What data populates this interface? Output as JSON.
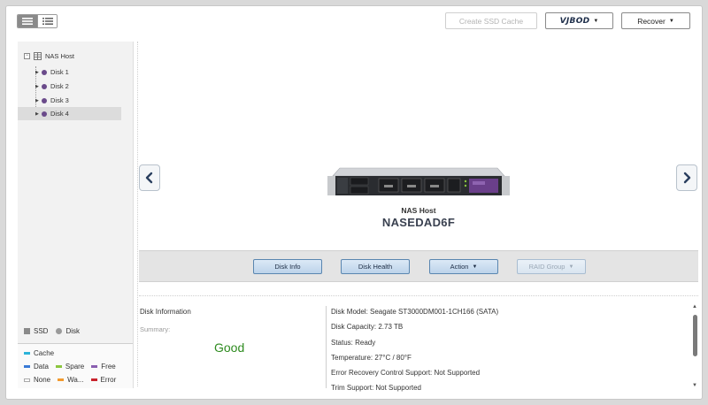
{
  "toolbar": {
    "create_ssd_cache": "Create SSD Cache",
    "vjbod": "VJBOD",
    "recover": "Recover"
  },
  "tree": {
    "root": "NAS Host",
    "items": [
      {
        "label": "Disk 1",
        "selected": false
      },
      {
        "label": "Disk 2",
        "selected": false
      },
      {
        "label": "Disk 3",
        "selected": false
      },
      {
        "label": "Disk 4",
        "selected": true
      }
    ]
  },
  "type_legend": {
    "ssd": "SSD",
    "disk": "Disk"
  },
  "status_legend": {
    "cache": "Cache",
    "data": "Data",
    "spare": "Spare",
    "free": "Free",
    "none": "None",
    "warning": "Wa...",
    "error": "Error"
  },
  "colors": {
    "cache": "#2bb3d9",
    "data": "#3a7ad6",
    "spare": "#8bc63f",
    "free": "#8a5fb0",
    "none": "#ffffff",
    "warning": "#f29a2e",
    "error": "#c8232c",
    "disk_dot": "#6a4a8a",
    "good": "#2e8b1f"
  },
  "device": {
    "type": "NAS Host",
    "name": "NASEDAD6F"
  },
  "actions": {
    "disk_info": "Disk Info",
    "disk_health": "Disk Health",
    "action": "Action",
    "raid_group": "RAID Group"
  },
  "info": {
    "title": "Disk Information",
    "summary_label": "Summary:",
    "summary_value": "Good",
    "lines": [
      "Disk Model: Seagate ST3000DM001-1CH166 (SATA)",
      "Disk Capacity: 2.73 TB",
      "Status: Ready",
      "Temperature: 27°C / 80°F",
      "Error Recovery Control Support: Not Supported",
      "Trim Support: Not Supported"
    ]
  }
}
